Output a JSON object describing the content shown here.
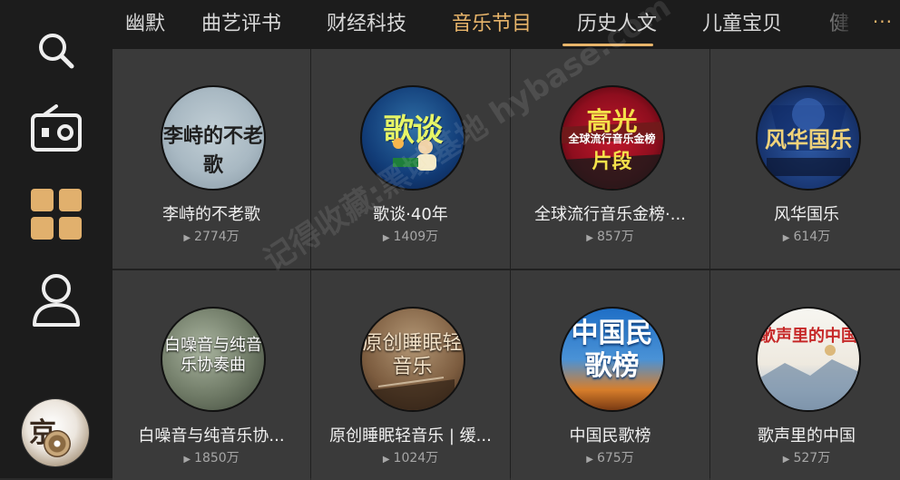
{
  "sidebar": {
    "items": [
      {
        "icon": "search-icon"
      },
      {
        "icon": "radio-icon"
      },
      {
        "icon": "category-grid-icon"
      },
      {
        "icon": "user-icon"
      }
    ],
    "avatar": {
      "icon": "album-avatar",
      "text": "京"
    }
  },
  "tabs": {
    "items": [
      "幽默",
      "曲艺评书",
      "财经科技",
      "音乐节目",
      "历史人文",
      "儿童宝贝",
      "健"
    ],
    "active_index": 3,
    "more_label": "···",
    "active_color": "#e7b46a"
  },
  "grid": {
    "items": [
      {
        "title": "李峙的不老歌",
        "plays": "2774万",
        "cover_text": "李峙的不老歌"
      },
      {
        "title": "歌谈·40年",
        "plays": "1409万",
        "cover_text": "歌谈"
      },
      {
        "title": "全球流行音乐金榜·...",
        "plays": "857万",
        "cover_text_big": "高光",
        "cover_text_small": "全球流行音乐金榜",
        "cover_text_big2": "片段"
      },
      {
        "title": "风华国乐",
        "plays": "614万",
        "cover_text": "风华国乐"
      },
      {
        "title": "白噪音与纯音乐协...",
        "plays": "1850万",
        "cover_text": "白噪音与纯音乐协奏曲"
      },
      {
        "title": "原创睡眠轻音乐 | 缓...",
        "plays": "1024万",
        "cover_text": "原创睡眠轻音乐"
      },
      {
        "title": "中国民歌榜",
        "plays": "675万",
        "cover_text": "中国民歌榜"
      },
      {
        "title": "歌声里的中国",
        "plays": "527万",
        "cover_text": "歌声里的中国"
      }
    ]
  },
  "watermark": {
    "text": "记得收藏:黑域基地 hybase.com"
  }
}
